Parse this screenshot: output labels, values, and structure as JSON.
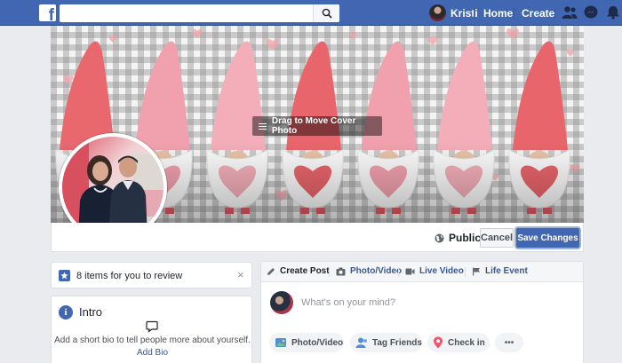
{
  "nav": {
    "logo": "f",
    "search_placeholder": "",
    "user_name": "Kristi",
    "home": "Home",
    "create": "Create",
    "icons": [
      "friends-icon",
      "messenger-icon",
      "notifications-icon"
    ]
  },
  "cover": {
    "drag_label": "Drag to Move Cover Photo",
    "gnome_hat_colors": [
      "#e8686e",
      "#f0a1ad",
      "#f3aeb9",
      "#e8656b",
      "#f0a1ad",
      "#f3aeb9",
      "#e8656b"
    ]
  },
  "cover_actions": {
    "privacy": "Public",
    "cancel": "Cancel",
    "save": "Save Changes"
  },
  "review": {
    "text": "8 items for you to review",
    "close": "×"
  },
  "intro": {
    "title": "Intro",
    "bio_prompt": "Add a short bio to tell people more about yourself.",
    "add_bio": "Add Bio"
  },
  "composer": {
    "tabs": [
      {
        "label": "Create Post",
        "icon": "pencil-icon"
      },
      {
        "label": "Photo/Video",
        "icon": "camera-icon"
      },
      {
        "label": "Live Video",
        "icon": "video-icon"
      },
      {
        "label": "Life Event",
        "icon": "flag-icon"
      }
    ],
    "placeholder": "What's on your mind?",
    "actions": [
      {
        "label": "Photo/Video",
        "icon": "photo-icon"
      },
      {
        "label": "Tag Friends",
        "icon": "tag-friends-icon"
      },
      {
        "label": "Check in",
        "icon": "location-pin-icon"
      },
      {
        "label": "•••",
        "icon": "more-icon"
      }
    ]
  },
  "colors": {
    "brand": "#4267b2",
    "link": "#365899",
    "background": "#e9ebee"
  }
}
